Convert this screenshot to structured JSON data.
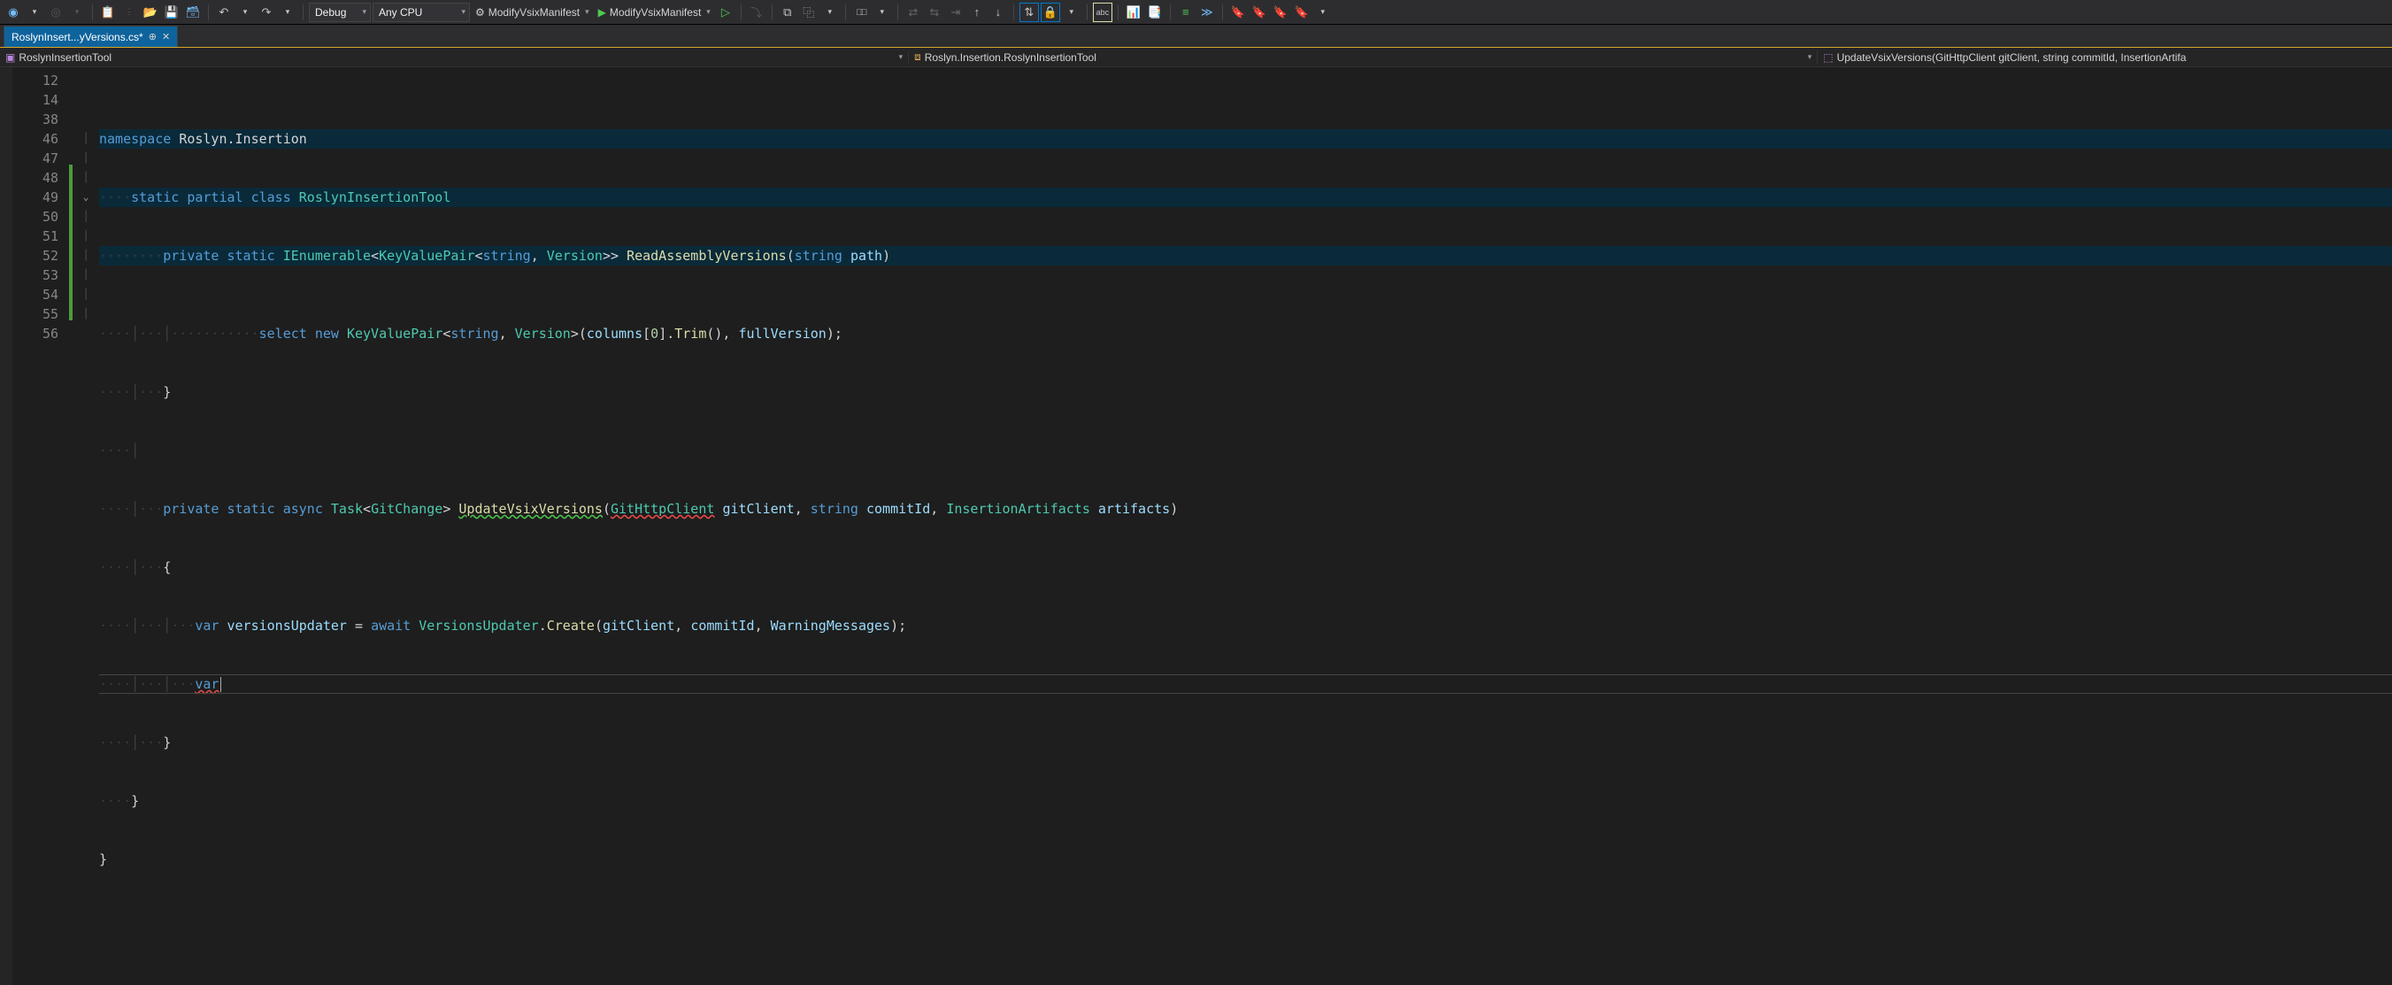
{
  "toolbar": {
    "config": "Debug",
    "platform": "Any CPU",
    "target1": "ModifyVsixManifest",
    "target2": "ModifyVsixManifest"
  },
  "tab": {
    "title": "RoslynInsert...yVersions.cs*"
  },
  "nav": {
    "seg1": "RoslynInsertionTool",
    "seg2": "Roslyn.Insertion.RoslynInsertionTool",
    "seg3": "UpdateVsixVersions(GitHttpClient gitClient, string commitId, InsertionArtifa"
  },
  "gutter": [
    "12",
    "14",
    "38",
    "46",
    "47",
    "48",
    "49",
    "50",
    "51",
    "52",
    "53",
    "54",
    "55",
    "56"
  ],
  "code": {
    "l12": {
      "kw1": "namespace",
      "ns": "Roslyn.Insertion"
    },
    "l14": {
      "kw1": "static",
      "kw2": "partial",
      "kw3": "class",
      "type": "RoslynInsertionTool"
    },
    "l38": {
      "kw1": "private",
      "kw2": "static",
      "type1": "IEnumerable",
      "type2": "KeyValuePair",
      "kw3": "string",
      "type3": "Version",
      "method": "ReadAssemblyVersions",
      "kw4": "string",
      "param": "path"
    },
    "l46": {
      "kw1": "select",
      "kw2": "new",
      "type1": "KeyValuePair",
      "kw3": "string",
      "type2": "Version",
      "id1": "columns",
      "idx": "0",
      "method1": "Trim",
      "id2": "fullVersion"
    },
    "l47": {
      "brace": "}"
    },
    "l49": {
      "kw1": "private",
      "kw2": "static",
      "kw3": "async",
      "type1": "Task",
      "type2": "GitChange",
      "method": "UpdateVsixVersions",
      "type3": "GitHttpClient",
      "p1": "gitClient",
      "kw4": "string",
      "p2": "commitId",
      "type4": "InsertionArtifacts",
      "p3": "artifacts"
    },
    "l50": {
      "brace": "{"
    },
    "l51": {
      "kw1": "var",
      "id1": "versionsUpdater",
      "kw2": "await",
      "type": "VersionsUpdater",
      "method": "Create",
      "a1": "gitClient",
      "a2": "commitId",
      "a3": "WarningMessages"
    },
    "l52": {
      "kw1": "var"
    },
    "l53": {
      "brace": "}"
    },
    "l54": {
      "brace": "}"
    },
    "l55": {
      "brace": "}"
    }
  }
}
